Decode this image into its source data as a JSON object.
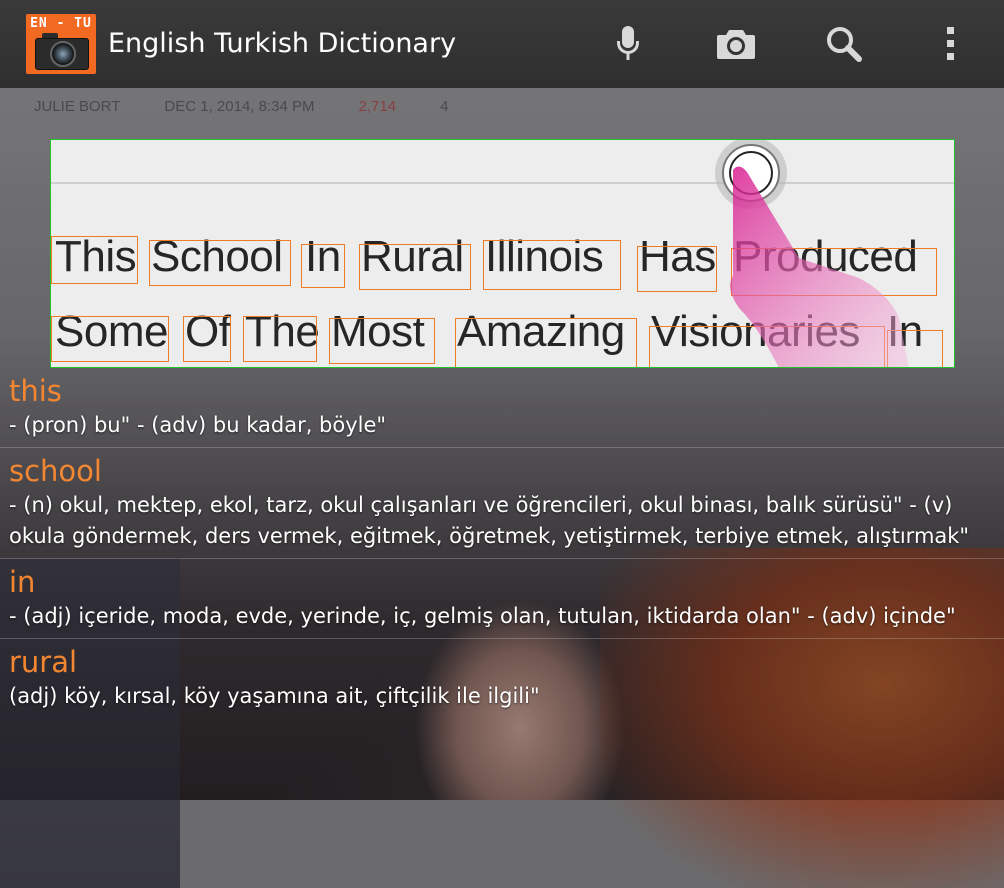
{
  "app": {
    "title": "English Turkish Dictionary",
    "logo_text": "EN - TU"
  },
  "toolbar": {
    "icons": [
      "microphone-icon",
      "camera-icon",
      "search-icon",
      "overflow-menu-icon"
    ]
  },
  "background_article": {
    "author": "JULIE BORT",
    "date": "DEC 1, 2014, 8:34 PM",
    "views": "2,714",
    "comments": "4"
  },
  "scan": {
    "line1": [
      "This",
      "School",
      "In",
      "Rural",
      "Illinois",
      "Has",
      "Produced"
    ],
    "line2": [
      "Some",
      "Of",
      "The",
      "Most",
      "Amazing",
      "Visionaries",
      "In"
    ]
  },
  "entries": [
    {
      "word": "this",
      "definition": " - (pron) bu\" - (adv) bu kadar, böyle\""
    },
    {
      "word": "school",
      "definition": " - (n) okul, mektep, ekol, tarz, okul çalışanları ve öğrencileri, okul binası, balık sürüsü\" - (v) okula göndermek, ders vermek, eğitmek, öğretmek, yetiştirmek, terbiye etmek, alıştırmak\""
    },
    {
      "word": "in",
      "definition": " - (adj) içeride, moda, evde, yerinde, iç, gelmiş olan, tutulan, iktidarda olan\" - (adv) içinde\""
    },
    {
      "word": "rural",
      "definition": "(adj) köy, kırsal, köy yaşamına ait, çiftçilik ile ilgili\""
    }
  ],
  "colors": {
    "accent": "#f38631",
    "word_box": "#ef7b24",
    "scan_border": "#22c32a",
    "appbar": "#333334"
  }
}
